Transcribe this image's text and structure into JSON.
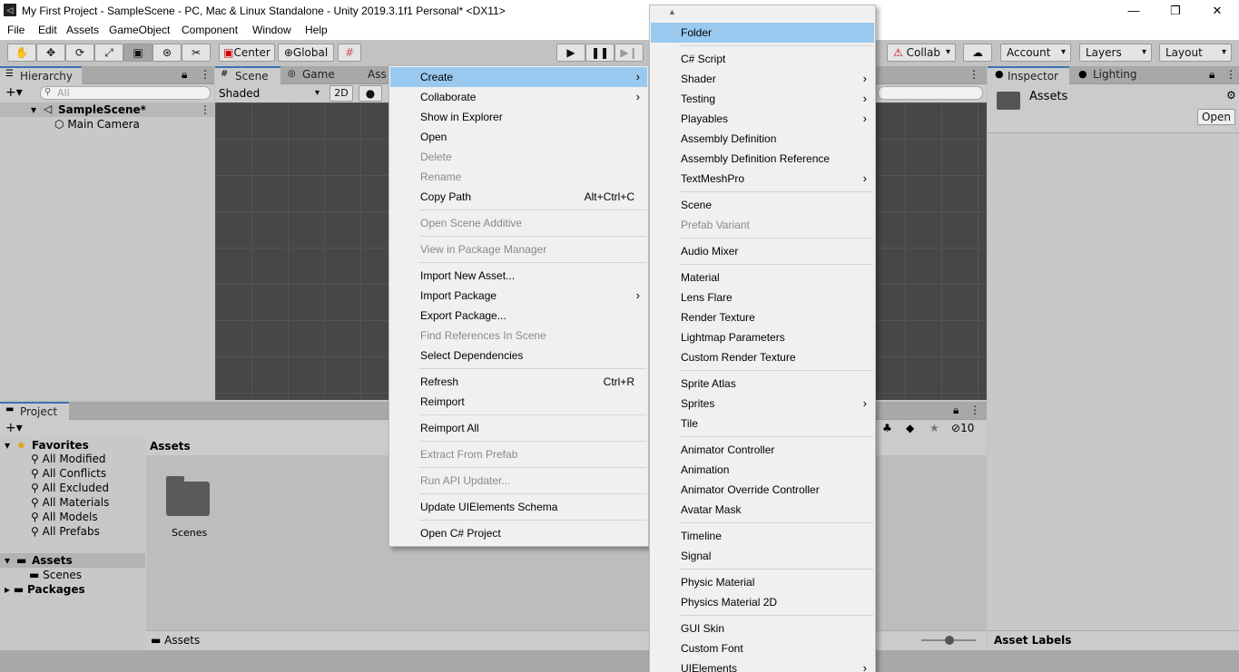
{
  "window": {
    "title": "My First Project - SampleScene - PC, Mac & Linux Standalone - Unity 2019.3.1f1 Personal* <DX11>",
    "minimize": "—",
    "maximize": "❐",
    "close": "✕"
  },
  "menubar": [
    "File",
    "Edit",
    "Assets",
    "GameObject",
    "Component",
    "Window",
    "Help"
  ],
  "toolbar": {
    "pivot": "Center",
    "space": "Global",
    "collab": "Collab",
    "account": "Account",
    "layers": "Layers",
    "layout": "Layout"
  },
  "hierarchy": {
    "tab": "Hierarchy",
    "search_placeholder": "All",
    "scene": "SampleScene*",
    "items": [
      "Main Camera"
    ]
  },
  "scene": {
    "tabs": [
      "Scene",
      "Game",
      "Ass"
    ],
    "shading": "Shaded",
    "mode2d": "2D"
  },
  "inspector": {
    "tabs": [
      "Inspector",
      "Lighting"
    ],
    "asset_name": "Assets",
    "open_button": "Open",
    "asset_labels": "Asset Labels"
  },
  "project": {
    "tab": "Project",
    "favorites_label": "Favorites",
    "favorites": [
      "All Modified",
      "All Conflicts",
      "All Excluded",
      "All Materials",
      "All Models",
      "All Prefabs"
    ],
    "assets_label": "Assets",
    "assets_children": [
      "Scenes"
    ],
    "packages_label": "Packages",
    "breadcrumb": "Assets",
    "grid_items": [
      "Scenes"
    ],
    "footer_path": "Assets",
    "hidden_count": "10"
  },
  "context_menu": [
    {
      "label": "Create",
      "arrow": "›",
      "state": "highlight"
    },
    {
      "label": "Collaborate",
      "arrow": "›"
    },
    {
      "label": "Show in Explorer"
    },
    {
      "label": "Open"
    },
    {
      "label": "Delete",
      "state": "disabled"
    },
    {
      "label": "Rename",
      "state": "disabled"
    },
    {
      "label": "Copy Path",
      "shortcut": "Alt+Ctrl+C"
    },
    {
      "label": "Open Scene Additive",
      "state": "disabled"
    },
    {
      "label": "View in Package Manager",
      "state": "disabled"
    },
    {
      "label": "Import New Asset..."
    },
    {
      "label": "Import Package",
      "arrow": "›"
    },
    {
      "label": "Export Package..."
    },
    {
      "label": "Find References In Scene",
      "state": "disabled"
    },
    {
      "label": "Select Dependencies"
    },
    {
      "label": "Refresh",
      "shortcut": "Ctrl+R"
    },
    {
      "label": "Reimport"
    },
    {
      "label": "Reimport All"
    },
    {
      "label": "Extract From Prefab",
      "state": "disabled"
    },
    {
      "label": "Run API Updater...",
      "state": "disabled"
    },
    {
      "label": "Update UIElements Schema"
    },
    {
      "label": "Open C# Project"
    }
  ],
  "create_submenu": [
    {
      "label": "Folder",
      "state": "highlight"
    },
    {
      "label": "C# Script"
    },
    {
      "label": "Shader",
      "arrow": "›"
    },
    {
      "label": "Testing",
      "arrow": "›"
    },
    {
      "label": "Playables",
      "arrow": "›"
    },
    {
      "label": "Assembly Definition"
    },
    {
      "label": "Assembly Definition Reference"
    },
    {
      "label": "TextMeshPro",
      "arrow": "›"
    },
    {
      "label": "Scene"
    },
    {
      "label": "Prefab Variant",
      "state": "disabled"
    },
    {
      "label": "Audio Mixer"
    },
    {
      "label": "Material"
    },
    {
      "label": "Lens Flare"
    },
    {
      "label": "Render Texture"
    },
    {
      "label": "Lightmap Parameters"
    },
    {
      "label": "Custom Render Texture"
    },
    {
      "label": "Sprite Atlas"
    },
    {
      "label": "Sprites",
      "arrow": "›"
    },
    {
      "label": "Tile"
    },
    {
      "label": "Animator Controller"
    },
    {
      "label": "Animation"
    },
    {
      "label": "Animator Override Controller"
    },
    {
      "label": "Avatar Mask"
    },
    {
      "label": "Timeline"
    },
    {
      "label": "Signal"
    },
    {
      "label": "Physic Material"
    },
    {
      "label": "Physics Material 2D"
    },
    {
      "label": "GUI Skin"
    },
    {
      "label": "Custom Font"
    },
    {
      "label": "UIElements",
      "arrow": "›"
    }
  ]
}
